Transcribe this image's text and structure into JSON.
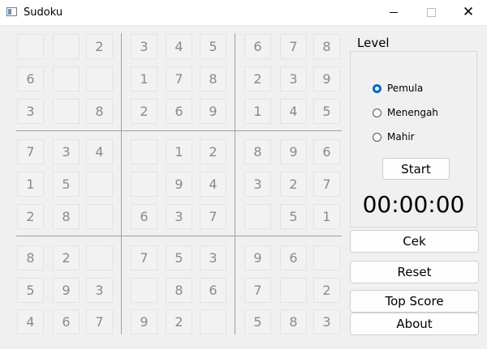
{
  "window": {
    "title": "Sudoku",
    "icon": "window-app-icon"
  },
  "board": [
    [
      "",
      "",
      "2",
      "3",
      "4",
      "5",
      "6",
      "7",
      "8"
    ],
    [
      "6",
      "",
      "",
      "1",
      "7",
      "8",
      "2",
      "3",
      "9"
    ],
    [
      "3",
      "",
      "8",
      "2",
      "6",
      "9",
      "1",
      "4",
      "5"
    ],
    [
      "7",
      "3",
      "4",
      "",
      "1",
      "2",
      "8",
      "9",
      "6"
    ],
    [
      "1",
      "5",
      "",
      "",
      "9",
      "4",
      "3",
      "2",
      "7"
    ],
    [
      "2",
      "8",
      "",
      "6",
      "3",
      "7",
      "",
      "5",
      "1"
    ],
    [
      "8",
      "2",
      "",
      "7",
      "5",
      "3",
      "9",
      "6",
      ""
    ],
    [
      "5",
      "9",
      "3",
      "",
      "8",
      "6",
      "7",
      "",
      "2"
    ],
    [
      "4",
      "6",
      "7",
      "9",
      "2",
      "",
      "5",
      "8",
      "3"
    ]
  ],
  "level": {
    "label": "Level",
    "options": [
      {
        "label": "Pemula",
        "checked": true
      },
      {
        "label": "Menengah",
        "checked": false
      },
      {
        "label": "Mahir",
        "checked": false
      }
    ],
    "start_label": "Start"
  },
  "timer": "00:00:00",
  "buttons": {
    "cek": "Cek",
    "reset": "Reset",
    "top_score": "Top Score",
    "about": "About"
  },
  "colors": {
    "accent": "#0067c0",
    "cell_text": "#8a8a8a"
  }
}
